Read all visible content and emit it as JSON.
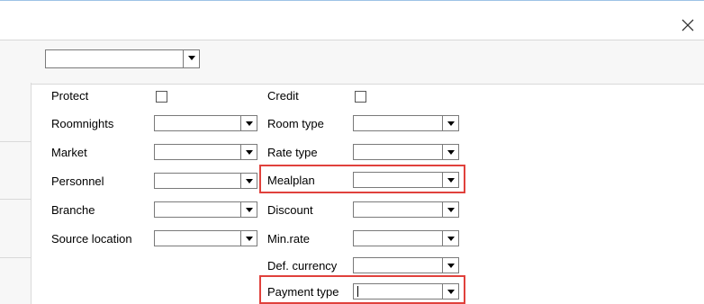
{
  "window": {
    "close_icon": "close-icon"
  },
  "toolbar": {
    "selector_value": ""
  },
  "left_column": {
    "protect_label": "Protect",
    "roomnights_label": "Roomnights",
    "market_label": "Market",
    "personnel_label": "Personnel",
    "branche_label": "Branche",
    "source_location_label": "Source location",
    "roomnights_value": "",
    "market_value": "",
    "personnel_value": "",
    "branche_value": "",
    "source_location_value": ""
  },
  "right_column": {
    "credit_label": "Credit",
    "room_type_label": "Room type",
    "rate_type_label": "Rate type",
    "mealplan_label": "Mealplan",
    "discount_label": "Discount",
    "min_rate_label": "Min.rate",
    "def_currency_label": "Def. currency",
    "payment_type_label": "Payment type",
    "room_type_value": "",
    "rate_type_value": "",
    "mealplan_value": "",
    "discount_value": "",
    "min_rate_value": "",
    "def_currency_value": "",
    "payment_type_value": ""
  },
  "colors": {
    "highlight": "#e0413c",
    "border": "#7a7a7a"
  }
}
